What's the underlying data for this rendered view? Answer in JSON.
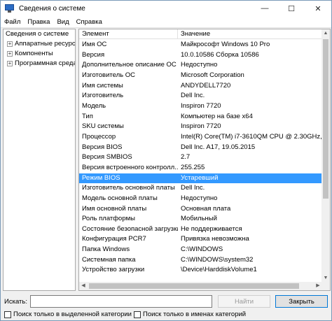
{
  "window": {
    "title": "Сведения о системе"
  },
  "controls": {
    "minimize": "—",
    "maximize": "☐",
    "close": "✕"
  },
  "menu": [
    "Файл",
    "Правка",
    "Вид",
    "Справка"
  ],
  "tree": {
    "root": "Сведения о системе",
    "children": [
      "Аппаратные ресурсы",
      "Компоненты",
      "Программная среда"
    ],
    "expander": "+"
  },
  "grid": {
    "headers": {
      "item": "Элемент",
      "value": "Значение"
    },
    "rows": [
      {
        "item": "Имя ОС",
        "value": "Майкрософт Windows 10 Pro"
      },
      {
        "item": "Версия",
        "value": "10.0.10586 Сборка 10586"
      },
      {
        "item": "Дополнительное описание ОС",
        "value": "Недоступно"
      },
      {
        "item": "Изготовитель ОС",
        "value": "Microsoft Corporation"
      },
      {
        "item": "Имя системы",
        "value": "ANDYDELL7720"
      },
      {
        "item": "Изготовитель",
        "value": "Dell Inc."
      },
      {
        "item": "Модель",
        "value": "Inspiron 7720"
      },
      {
        "item": "Тип",
        "value": "Компьютер на базе x64"
      },
      {
        "item": "SKU системы",
        "value": "Inspiron 7720"
      },
      {
        "item": "Процессор",
        "value": "Intel(R) Core(TM) i7-3610QM CPU @ 2.30GHz, 23"
      },
      {
        "item": "Версия BIOS",
        "value": "Dell Inc. A17, 19.05.2015"
      },
      {
        "item": "Версия SMBIOS",
        "value": "2.7"
      },
      {
        "item": "Версия встроенного контролл...",
        "value": "255.255"
      },
      {
        "item": "Режим BIOS",
        "value": "Устаревший"
      },
      {
        "item": "Изготовитель основной платы",
        "value": "Dell Inc."
      },
      {
        "item": "Модель основной платы",
        "value": "Недоступно"
      },
      {
        "item": "Имя основной платы",
        "value": "Основная плата"
      },
      {
        "item": "Роль платформы",
        "value": "Мобильный"
      },
      {
        "item": "Состояние безопасной загрузки",
        "value": "Не поддерживается"
      },
      {
        "item": "Конфигурация PCR7",
        "value": "Привязка невозможна"
      },
      {
        "item": "Папка Windows",
        "value": "C:\\WINDOWS"
      },
      {
        "item": "Системная папка",
        "value": "C:\\WINDOWS\\system32"
      },
      {
        "item": "Устройство загрузки",
        "value": "\\Device\\HarddiskVolume1"
      }
    ],
    "selected_index": 13
  },
  "scroll_glyphs": {
    "up": "▲",
    "down": "▼",
    "left": "◀",
    "right": "▶"
  },
  "search": {
    "label": "Искать:",
    "value": "",
    "find_button": "Найти",
    "close_button": "Закрыть",
    "checkbox_selected_category": "Поиск только в выделенной категории",
    "checkbox_category_names": "Поиск только в именах категорий"
  }
}
